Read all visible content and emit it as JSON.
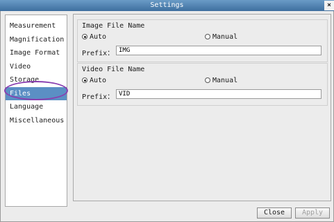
{
  "window": {
    "title": "Settings",
    "close_glyph": "×"
  },
  "sidebar": {
    "items": [
      {
        "label": "Measurement",
        "selected": false
      },
      {
        "label": "Magnification",
        "selected": false
      },
      {
        "label": "Image Format",
        "selected": false
      },
      {
        "label": "Video",
        "selected": false
      },
      {
        "label": "Storage",
        "selected": false
      },
      {
        "label": "Files",
        "selected": true
      },
      {
        "label": "Language",
        "selected": false
      },
      {
        "label": "Miscellaneous",
        "selected": false
      }
    ],
    "selected_color": "#5b8fc4",
    "highlight_ring_color": "#8a3fb0"
  },
  "image_group": {
    "title": "Image File Name",
    "auto_label": "Auto",
    "manual_label": "Manual",
    "selected": "Auto",
    "prefix_label": "Prefix：",
    "prefix_value": "IMG"
  },
  "video_group": {
    "title": "Video File Name",
    "auto_label": "Auto",
    "manual_label": "Manual",
    "selected": "Auto",
    "prefix_label": "Prefix：",
    "prefix_value": "VID"
  },
  "buttons": {
    "close": "Close",
    "apply": "Apply",
    "apply_enabled": false
  },
  "colors": {
    "titlebar": "#4f80b0",
    "window_bg": "#ececec"
  }
}
